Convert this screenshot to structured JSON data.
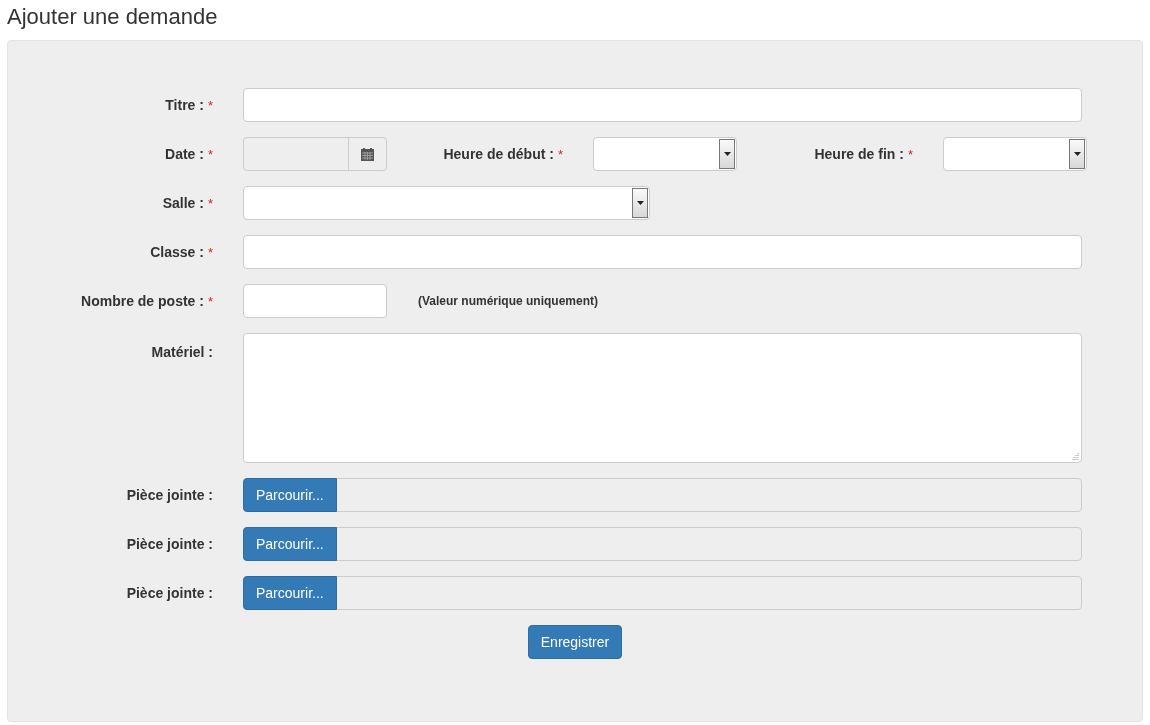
{
  "title": "Ajouter une demande",
  "rows": [
    {
      "kind": "text",
      "label": "Titre :",
      "mark": "*"
    },
    {
      "kind": "datetime",
      "label": "Date :",
      "mark": "*",
      "times": [
        {
          "label": "Heure de début :",
          "mark": "*"
        },
        {
          "label": "Heure de fin :",
          "mark": "*"
        }
      ]
    },
    {
      "kind": "select",
      "label": "Salle :",
      "mark": "*"
    },
    {
      "kind": "text",
      "label": "Classe :",
      "mark": "*"
    },
    {
      "kind": "number",
      "label": "Nombre de poste :",
      "mark": "*",
      "hint": "(Valeur numérique uniquement)"
    },
    {
      "kind": "textarea",
      "label": "Matériel :"
    },
    {
      "kind": "file",
      "label": "Pièce jointe :",
      "button": "Parcourir..."
    },
    {
      "kind": "file",
      "label": "Pièce jointe :",
      "button": "Parcourir..."
    },
    {
      "kind": "file",
      "label": "Pièce jointe :",
      "button": "Parcourir..."
    }
  ],
  "submit": "Enregistrer"
}
